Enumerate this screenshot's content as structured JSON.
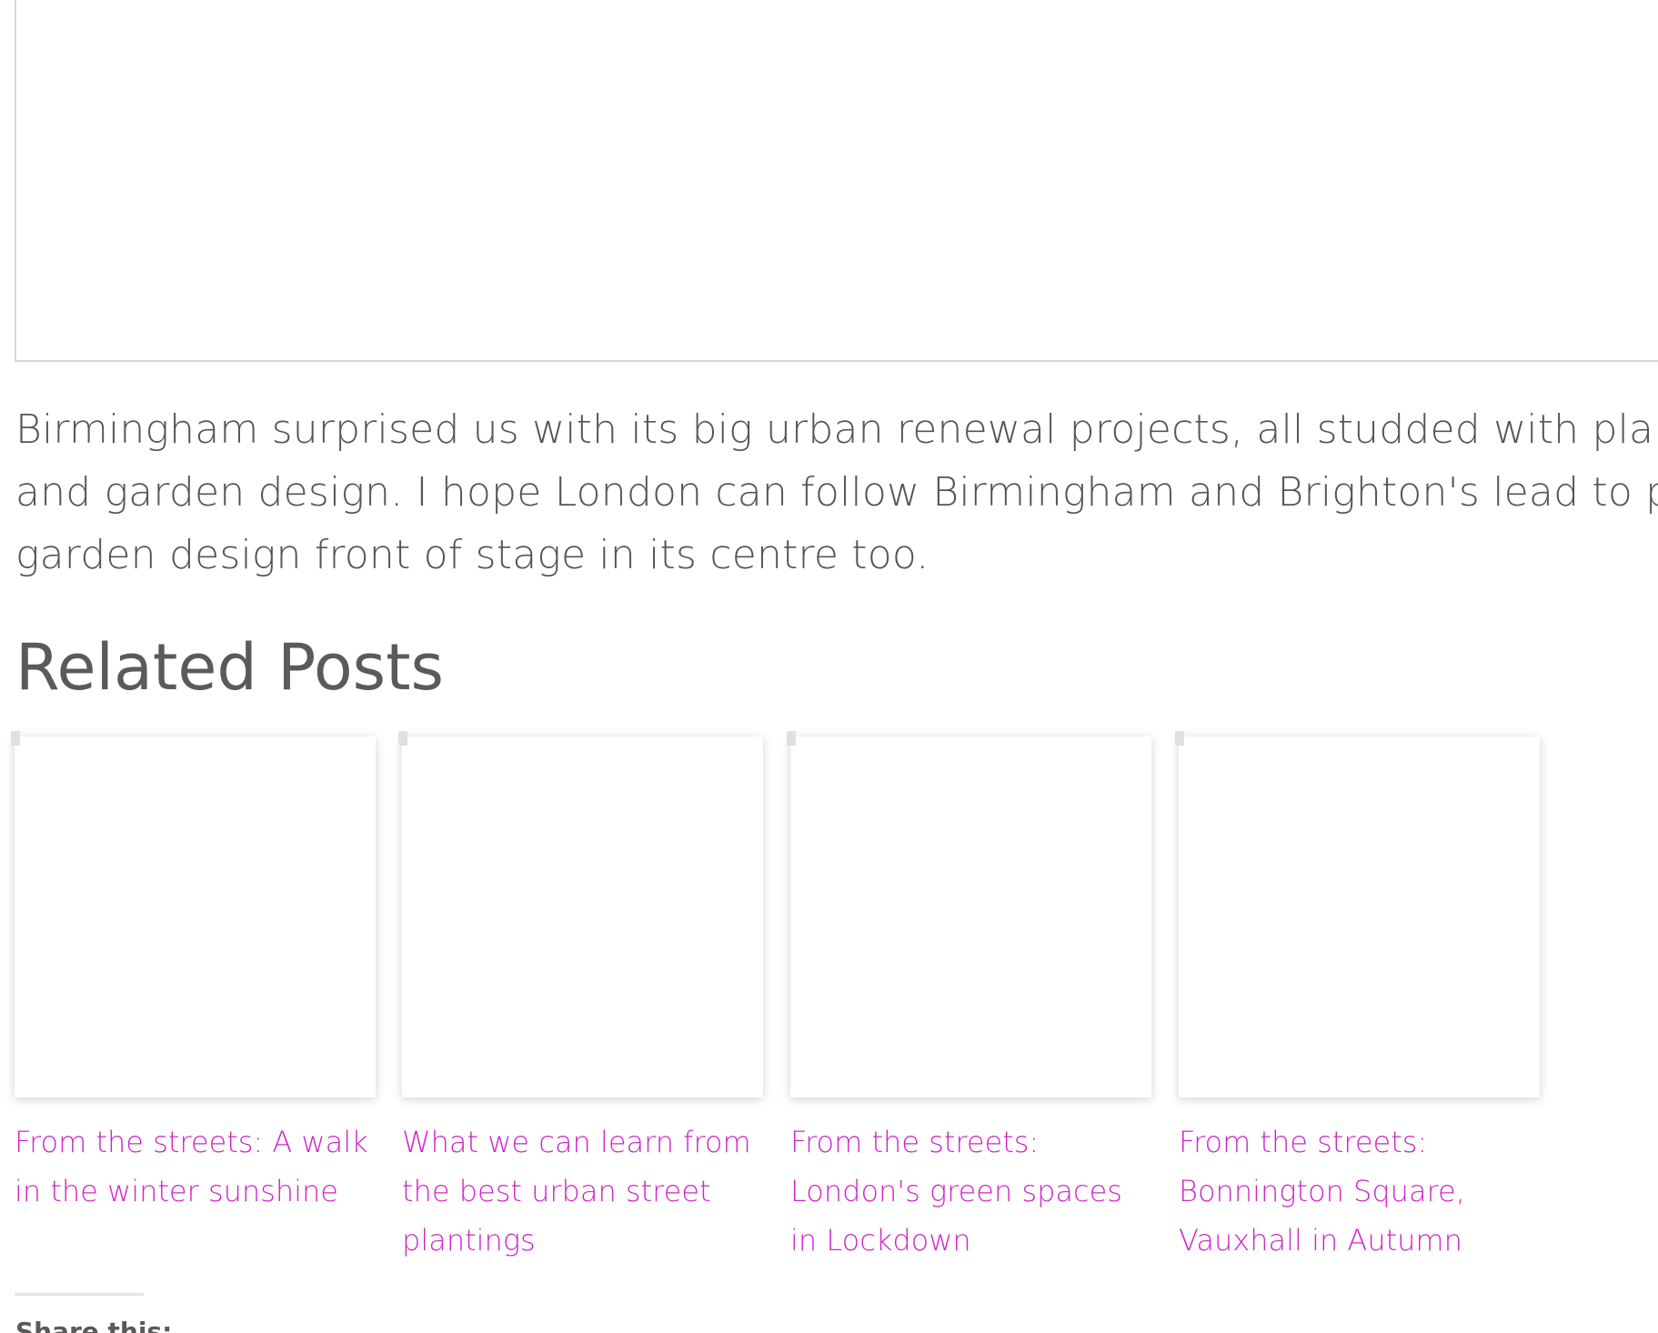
{
  "article": {
    "paragraph": "Birmingham surprised us with its big urban renewal projects, all studded with plants and garden design. I hope London can follow Birmingham and Brighton's lead to put garden design front of stage in its centre too."
  },
  "related": {
    "heading": "Related Posts",
    "posts": [
      {
        "title": "From the streets: A walk in the winter sunshine"
      },
      {
        "title": "What we can learn from the best urban street plantings"
      },
      {
        "title": "From the streets: London's green spaces in Lockdown"
      },
      {
        "title": "From the streets: Bonnington Square, Vauxhall in Autumn"
      }
    ]
  },
  "share": {
    "label": "Share this:"
  },
  "colors": {
    "link": "#d026c8",
    "text": "#555555",
    "heading": "#5a5a5a",
    "border": "#d6d6d6"
  }
}
